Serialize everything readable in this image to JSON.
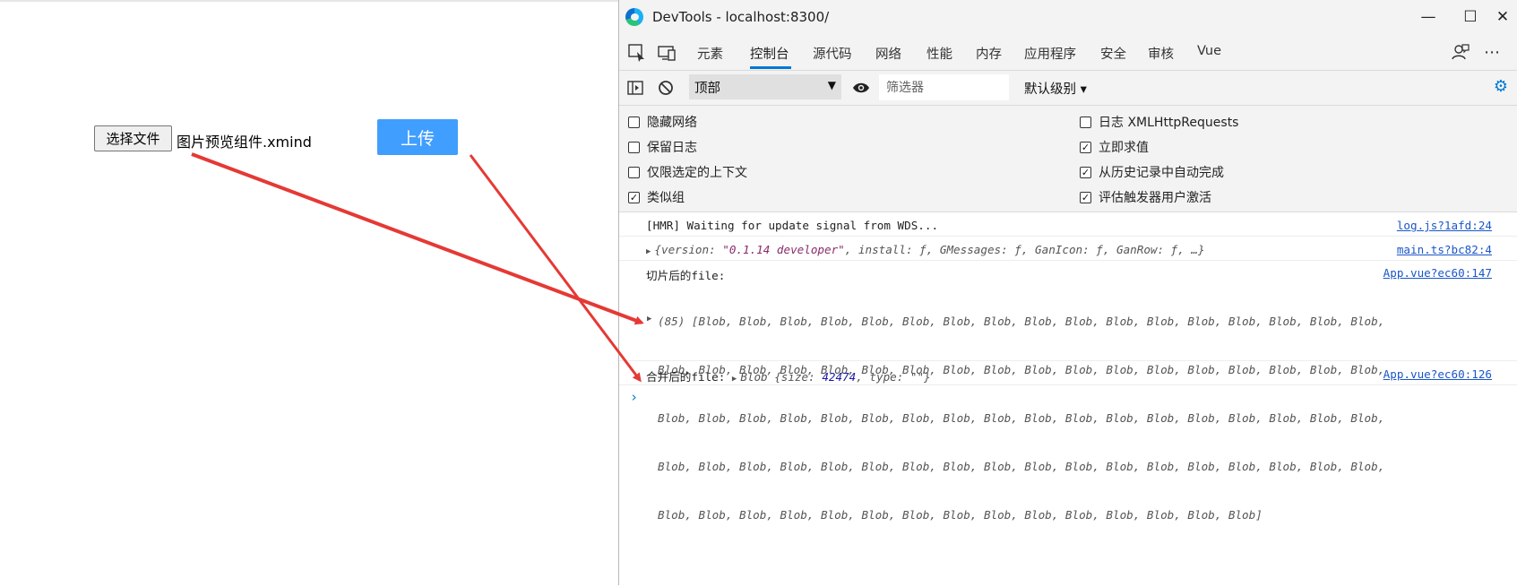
{
  "page": {
    "file_button_label": "选择文件",
    "file_name": "图片预览组件.xmind",
    "upload_button_label": "上传"
  },
  "devtools": {
    "window_title": "DevTools - localhost:8300/",
    "window_controls": [
      "minimize-icon",
      "maximize-icon",
      "close-icon"
    ],
    "tabs": [
      {
        "label": "元素",
        "active": false
      },
      {
        "label": "控制台",
        "active": true
      },
      {
        "label": "源代码",
        "active": false
      },
      {
        "label": "网络",
        "active": false
      },
      {
        "label": "性能",
        "active": false
      },
      {
        "label": "内存",
        "active": false
      },
      {
        "label": "应用程序",
        "active": false
      },
      {
        "label": "安全",
        "active": false
      },
      {
        "label": "审核",
        "active": false
      },
      {
        "label": "Vue",
        "active": false
      }
    ],
    "accent_color": "#0078d4",
    "toolbar": {
      "context": "顶部",
      "filter_placeholder": "筛选器",
      "levels": "默认级别 ▾"
    },
    "settings": {
      "left": [
        {
          "label": "隐藏网络",
          "checked": false
        },
        {
          "label": "保留日志",
          "checked": false
        },
        {
          "label": "仅限选定的上下文",
          "checked": false
        },
        {
          "label": "类似组",
          "checked": true
        }
      ],
      "right": [
        {
          "label": "日志 XMLHttpRequests",
          "checked": false
        },
        {
          "label": "立即求值",
          "checked": true
        },
        {
          "label": "从历史记录中自动完成",
          "checked": true
        },
        {
          "label": "评估触发器用户激活",
          "checked": true
        }
      ]
    },
    "console": {
      "hmr_message": "[HMR] Waiting for update signal from WDS...",
      "hmr_source": "log.js?1afd:24",
      "obj_prefix": "{version: ",
      "obj_version": "\"0.1.14 developer\"",
      "obj_rest": ", install: ƒ, GMessages: ƒ, GanIcon: ƒ, GanRow: ƒ, …}",
      "obj_source": "main.ts?bc82:4",
      "slice_label": "切片后的file:",
      "slice_source": "App.vue?ec60:147",
      "slice_lines": [
        "(85) [Blob, Blob, Blob, Blob, Blob, Blob, Blob, Blob, Blob, Blob, Blob, Blob, Blob, Blob, Blob, Blob, Blob,",
        "Blob, Blob, Blob, Blob, Blob, Blob, Blob, Blob, Blob, Blob, Blob, Blob, Blob, Blob, Blob, Blob, Blob, Blob,",
        "Blob, Blob, Blob, Blob, Blob, Blob, Blob, Blob, Blob, Blob, Blob, Blob, Blob, Blob, Blob, Blob, Blob, Blob,",
        "Blob, Blob, Blob, Blob, Blob, Blob, Blob, Blob, Blob, Blob, Blob, Blob, Blob, Blob, Blob, Blob, Blob, Blob,",
        "Blob, Blob, Blob, Blob, Blob, Blob, Blob, Blob, Blob, Blob, Blob, Blob, Blob, Blob, Blob]"
      ],
      "merge_label": "合并后的file:",
      "merge_blob": "Blob {size: ",
      "merge_size": "42474",
      "merge_type": ", type: \"\"}",
      "merge_source": "App.vue?ec60:126",
      "prompt": "›"
    }
  },
  "annotation_color": "#e53935"
}
